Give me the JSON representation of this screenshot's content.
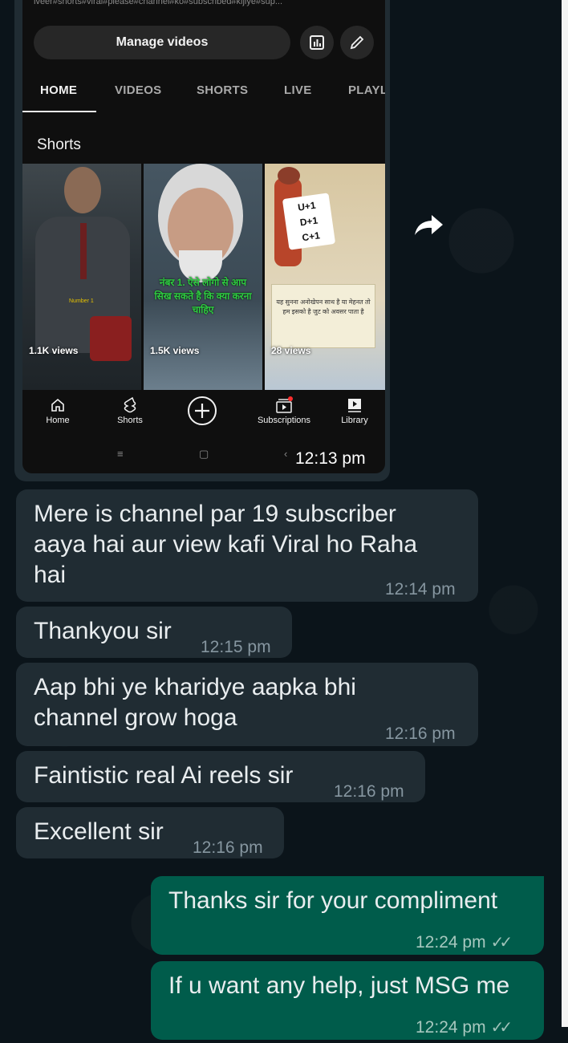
{
  "screenshot": {
    "hashtags": "lveer#shorts#viral#please#channel#ko#subscribed#kijiye#sup...",
    "manage_videos": "Manage videos",
    "tabs": [
      "HOME",
      "VIDEOS",
      "SHORTS",
      "LIVE",
      "PLAYL"
    ],
    "shorts_title": "Shorts",
    "shorts": [
      {
        "views": "1.1K views",
        "caption": "Number 1"
      },
      {
        "views": "1.5K views",
        "caption": "नंबर 1. ऐसे लोगो से आप सिख सकते है कि क्या करना चाहिए"
      },
      {
        "views": "28 views",
        "board": [
          "U+1",
          "D+1",
          "C+1"
        ],
        "caption": "यह सुनना अनोखेपन साथ है या मेहनत तो हम इसको है जुट को अवसर पाता है"
      }
    ],
    "bottom_nav": [
      "Home",
      "Shorts",
      "",
      "Subscriptions",
      "Library"
    ],
    "time": "12:13 pm"
  },
  "messages": [
    {
      "direction": "in",
      "lines": [
        "Mere is channel par 19 subscriber",
        "aaya hai aur view kafi Viral ho Raha",
        "hai"
      ],
      "time": "12:14 pm"
    },
    {
      "direction": "in",
      "lines": [
        "Thankyou sir"
      ],
      "time": "12:15 pm"
    },
    {
      "direction": "in",
      "lines": [
        "Aap bhi ye kharidye aapka bhi",
        "channel grow hoga"
      ],
      "time": "12:16 pm"
    },
    {
      "direction": "in",
      "lines": [
        "Faintistic real Ai reels sir"
      ],
      "time": "12:16 pm"
    },
    {
      "direction": "in",
      "lines": [
        "Excellent sir"
      ],
      "time": "12:16 pm"
    },
    {
      "direction": "out",
      "lines": [
        "Thanks sir for your compliment"
      ],
      "time": "12:24 pm"
    },
    {
      "direction": "out",
      "lines": [
        "If u want any help, just MSG me"
      ],
      "time": "12:24 pm"
    }
  ],
  "icons": [
    "share-forward-icon",
    "analytics-icon",
    "edit-pencil-icon",
    "home-icon",
    "shorts-icon",
    "create-plus-icon",
    "subscriptions-icon",
    "library-icon",
    "double-check-icon"
  ]
}
